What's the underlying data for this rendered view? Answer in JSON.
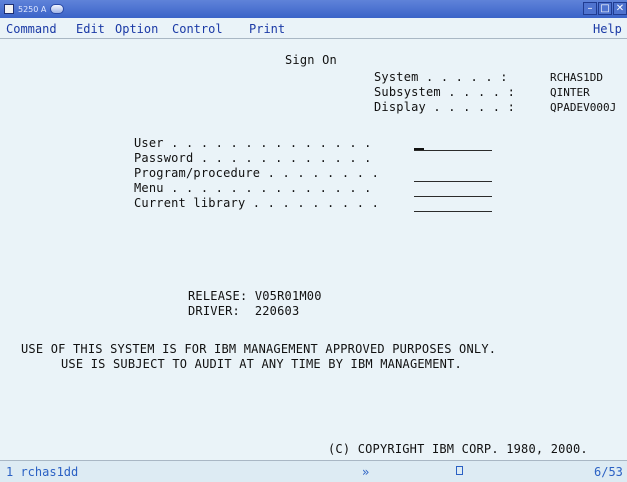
{
  "window": {
    "title": "5250 A"
  },
  "menu": {
    "items": [
      "Command",
      "Edit",
      "Option",
      "Control",
      "Print"
    ],
    "help": "Help"
  },
  "signon": {
    "title": "Sign On",
    "system_label": "System . . . . . :",
    "system_value": "RCHAS1DD",
    "subsystem_label": "Subsystem . . . . :",
    "subsystem_value": "QINTER",
    "display_label": "Display . . . . . :",
    "display_value": "QPADEV000J",
    "fields": [
      {
        "label": "User . . . . . . . . . . . . . ."
      },
      {
        "label": "Password . . . . . . . . . . . ."
      },
      {
        "label": "Program/procedure . . . . . . . ."
      },
      {
        "label": "Menu . . . . . . . . . . . . . ."
      },
      {
        "label": "Current library . . . . . . . . ."
      }
    ],
    "release_line": "RELEASE: V05R01M00",
    "driver_line": "DRIVER:  220603",
    "notice_line1": "USE OF THIS SYSTEM IS FOR IBM MANAGEMENT APPROVED PURPOSES ONLY.",
    "notice_line2": "USE IS SUBJECT TO AUDIT AT ANY TIME BY IBM MANAGEMENT.",
    "copyright": "(C) COPYRIGHT IBM CORP. 1980, 2000."
  },
  "status": {
    "session": "1 rchas1dd",
    "indicator": "»",
    "icon": "document-icon",
    "position": "6/53"
  }
}
